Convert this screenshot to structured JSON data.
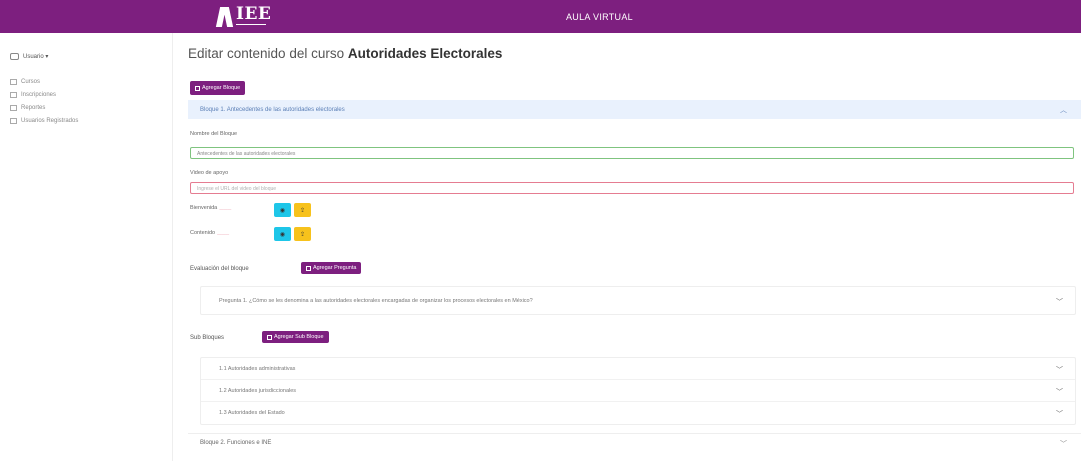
{
  "header": {
    "logo_text": "IEE",
    "app_title": "AULA VIRTUAL"
  },
  "sidebar": {
    "user_label": "Usuario ▾",
    "items": [
      {
        "label": "Cursos",
        "icon": "grid-icon"
      },
      {
        "label": "Inscripciones",
        "icon": "list-icon"
      },
      {
        "label": "Reportes",
        "icon": "report-icon"
      },
      {
        "label": "Usuarios Registrados",
        "icon": "users-icon"
      }
    ]
  },
  "main": {
    "title_prefix": "Editar contenido del curso",
    "course_name": "Autoridades Electorales",
    "add_block_label": "Agregar Bloque",
    "block1": {
      "header": "Bloque 1. Antecedentes de las autoridades electorales",
      "name_label": "Nombre del Bloque",
      "name_value": "Antecedentes de las autoridades electorales",
      "video_label": "Video de apoyo",
      "video_placeholder": "Ingrese el URL del video del bloque",
      "intro_label": "Bienvenida",
      "content_label": "Contenido",
      "view_icon": "view-icon",
      "upload_icon": "upload-icon",
      "evaluation_label": "Evaluación del bloque",
      "add_question_label": "Agregar Pregunta",
      "questions": [
        "Pregunta 1. ¿Cómo se les denomina a las autoridades electorales encargadas de organizar los procesos electorales en México?"
      ],
      "subblocks_label": "Sub Bloques",
      "add_subblock_label": "Agregar Sub Bloque",
      "subblocks": [
        "1.1 Autoridades administrativas",
        "1.2 Autoridades jurisdiccionales",
        "1.3 Autoridades del Estado"
      ]
    },
    "block2": {
      "header": "Bloque 2. Funciones e INE"
    }
  },
  "colors": {
    "brand": "#7d1f7f",
    "accent_blue": "#1ec6e8",
    "accent_yellow": "#f7c21c",
    "valid_border": "#7fc47f",
    "invalid_border": "#e57c91"
  }
}
